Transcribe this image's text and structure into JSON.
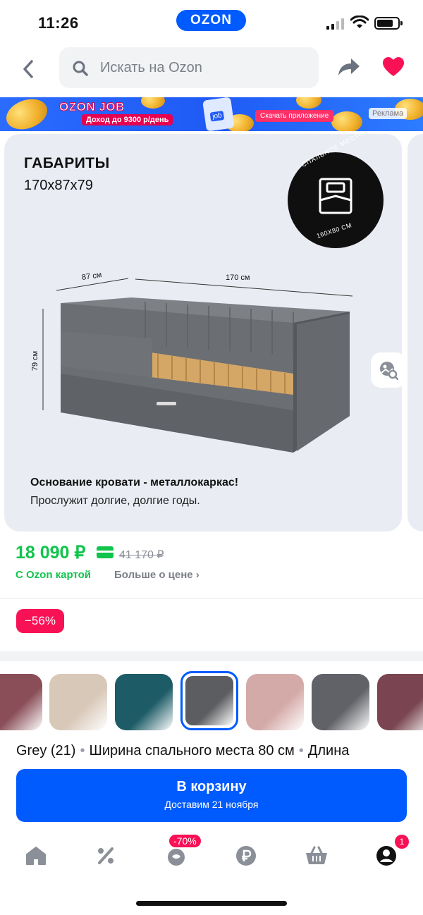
{
  "status_bar": {
    "time": "11:26",
    "logo": "OZON"
  },
  "header": {
    "search_placeholder": "Искать на Ozon",
    "icons": [
      "chevron-left-icon",
      "search-icon",
      "share-icon",
      "heart-icon"
    ]
  },
  "banner": {
    "title": "OZON JOB",
    "subtitle": "Доход до 9300 р/день",
    "phone_label": "job",
    "cta": "Скачать приложение",
    "ad_label": "Реклама"
  },
  "gallery": {
    "dims_title": "ГАБАРИТЫ",
    "dims_value": "170х87х79",
    "badge_top": "СПАЛЬНОЕ МЕСТО",
    "badge_bottom": "160Х80 СМ",
    "label_width": "87 см",
    "label_length": "170 см",
    "label_height": "79 см",
    "feature_title": "Основание кровати - металлокаркас!",
    "feature_desc": "Прослужит долгие, долгие годы."
  },
  "price": {
    "current": "18 090 ₽",
    "old": "41 170 ₽",
    "card_label": "С Ozon картой",
    "more_label": "Больше о цене ›",
    "discount": "−56%"
  },
  "swatches": {
    "colors": [
      "#8a4e58",
      "#d8c8b8",
      "#1d5b66",
      "#5c5d60",
      "#d4aaa8",
      "#606267",
      "#7a4550"
    ],
    "selected_index": 3
  },
  "variant": {
    "color": "Grey (21)",
    "width": "Ширина спального места 80 см",
    "length": "Длина",
    "separator": "•"
  },
  "cart": {
    "label": "В корзину",
    "delivery": "Доставим 21 ноября"
  },
  "bottom_nav": {
    "items": [
      "home-icon",
      "percent-icon",
      "fresh-icon",
      "ruble-icon",
      "basket-icon",
      "profile-icon"
    ],
    "promo_badge": "-70%",
    "profile_count": "1"
  },
  "colors": {
    "brand": "#005bff",
    "price_green": "#10c44c",
    "discount_red": "#f91155"
  }
}
